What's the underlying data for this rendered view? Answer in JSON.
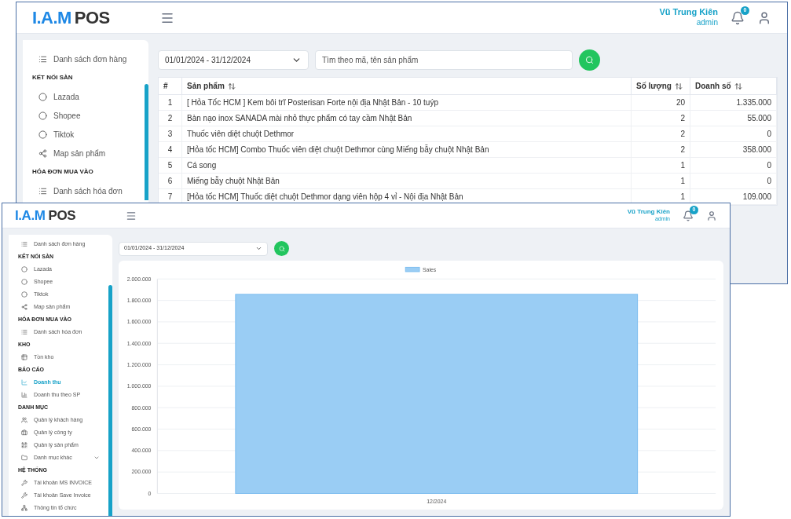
{
  "windows": [
    {
      "kind": "table",
      "header": {
        "logo_brand": "I.A.M",
        "logo_product": "POS",
        "user_name": "Vũ Trung Kiên",
        "user_role": "admin",
        "notification_count": "0"
      },
      "sidebar": {
        "items": [
          {
            "kind": "link",
            "label": "Danh sách đơn hàng",
            "selected": false
          },
          {
            "kind": "heading",
            "label": "KẾT NỐI SÀN"
          },
          {
            "kind": "link",
            "label": "Lazada",
            "selected": false
          },
          {
            "kind": "link",
            "label": "Shopee",
            "selected": false
          },
          {
            "kind": "link",
            "label": "Tiktok",
            "selected": false
          },
          {
            "kind": "link",
            "label": "Map sản phẩm",
            "selected": false
          },
          {
            "kind": "heading",
            "label": "HÓA ĐƠN MUA VÀO"
          },
          {
            "kind": "link",
            "label": "Danh sách hóa đơn",
            "selected": false
          }
        ]
      },
      "date_range": "01/01/2024 - 31/12/2024",
      "search": {
        "placeholder": "Tìm theo mã, tên sản phẩm"
      },
      "table": {
        "columns": [
          "#",
          "Sản phẩm",
          "Số lượng",
          "Doanh số"
        ],
        "rows": [
          [
            "1",
            "[ Hỏa Tốc HCM ] Kem bôi trĩ Posterisan Forte nội địa Nhật Bản - 10 tuýp",
            "20",
            "1.335.000"
          ],
          [
            "2",
            "Bàn nạo inox SANADA mài nhỏ thực phẩm có tay cầm Nhật Bản",
            "2",
            "55.000"
          ],
          [
            "3",
            "Thuốc viên diệt chuột Dethmor",
            "2",
            "0"
          ],
          [
            "4",
            "[Hỏa tốc HCM] Combo Thuốc viên diệt chuột Dethmor cùng Miếng bẫy chuột Nhật Bản",
            "2",
            "358.000"
          ],
          [
            "5",
            "Cá song",
            "1",
            "0"
          ],
          [
            "6",
            "Miếng bẫy chuột Nhật Bản",
            "1",
            "0"
          ],
          [
            "7",
            "[Hỏa tốc HCM] Thuốc diệt chuột Dethmor dạng viên hộp 4 vỉ - Nội địa Nhật Bản",
            "1",
            "109.000"
          ]
        ]
      }
    },
    {
      "kind": "chart",
      "header": {
        "logo_brand": "I.A.M",
        "logo_product": "POS",
        "user_name": "Vũ Trung Kiên",
        "user_role": "admin",
        "notification_count": "0"
      },
      "sidebar": {
        "items": [
          {
            "kind": "link",
            "label": "Danh sách đơn hàng",
            "selected": false
          },
          {
            "kind": "heading",
            "label": "KẾT NỐI SÀN"
          },
          {
            "kind": "link",
            "label": "Lazada",
            "selected": false
          },
          {
            "kind": "link",
            "label": "Shopee",
            "selected": false
          },
          {
            "kind": "link",
            "label": "Tiktok",
            "selected": false
          },
          {
            "kind": "link",
            "label": "Map sản phẩm",
            "selected": false
          },
          {
            "kind": "heading",
            "label": "HÓA ĐƠN MUA VÀO"
          },
          {
            "kind": "link",
            "label": "Danh sách hóa đơn",
            "selected": false
          },
          {
            "kind": "heading",
            "label": "KHO"
          },
          {
            "kind": "link",
            "label": "Tồn kho",
            "selected": false
          },
          {
            "kind": "heading",
            "label": "BÁO CÁO"
          },
          {
            "kind": "link",
            "label": "Doanh thu",
            "selected": true
          },
          {
            "kind": "link",
            "label": "Doanh thu theo SP",
            "selected": false
          },
          {
            "kind": "heading",
            "label": "DANH MỤC"
          },
          {
            "kind": "link",
            "label": "Quản lý khách hàng",
            "selected": false
          },
          {
            "kind": "link",
            "label": "Quản lý công ty",
            "selected": false
          },
          {
            "kind": "link",
            "label": "Quản lý sản phẩm",
            "selected": false
          },
          {
            "kind": "link",
            "label": "Danh mục khác",
            "selected": false,
            "expanded": false
          },
          {
            "kind": "heading",
            "label": "HỆ THỐNG"
          },
          {
            "kind": "link",
            "label": "Tài khoản MS INVOICE",
            "selected": false
          },
          {
            "kind": "link",
            "label": "Tài khoản Save Invoice",
            "selected": false
          },
          {
            "kind": "link",
            "label": "Thông tin tổ chức",
            "selected": false
          }
        ]
      },
      "date_range": "01/01/2024 - 31/12/2024",
      "chart_data": {
        "type": "bar",
        "categories": [
          "12/2024"
        ],
        "series": [
          {
            "name": "Sales",
            "color": "#9acdf4",
            "values": [
              1857000
            ]
          }
        ],
        "ylim": [
          0,
          2000000
        ],
        "grid": true,
        "yticks": [
          {
            "value": 0,
            "label": "0"
          },
          {
            "value": 200000,
            "label": "200.000"
          },
          {
            "value": 400000,
            "label": "400.000"
          },
          {
            "value": 600000,
            "label": "600.000"
          },
          {
            "value": 800000,
            "label": "800.000"
          },
          {
            "value": 1000000,
            "label": "1.000.000"
          },
          {
            "value": 1200000,
            "label": "1.200.000"
          },
          {
            "value": 1400000,
            "label": "1.400.000"
          },
          {
            "value": 1600000,
            "label": "1.600.000"
          },
          {
            "value": 1800000,
            "label": "1.800.000"
          },
          {
            "value": 2000000,
            "label": "2.000.000"
          }
        ]
      }
    }
  ]
}
